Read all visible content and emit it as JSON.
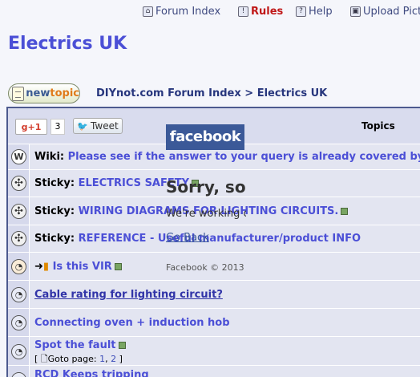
{
  "topnav": {
    "forum_index": "Forum Index",
    "rules": "Rules",
    "help": "Help",
    "upload": "Upload Pict"
  },
  "site_title": "Electrics UK",
  "newtopic": {
    "pre": "new",
    "post": "topic"
  },
  "breadcrumb": {
    "index": "DIYnot.com Forum Index",
    "sep": ">",
    "current": "Electrics UK"
  },
  "social": {
    "gplus_label": "g+1",
    "gplus_count": "3",
    "tweet_label": "Tweet"
  },
  "table": {
    "topics_header": "Topics"
  },
  "rows": [
    {
      "prefix": "Wiki:",
      "title": "Please see if the answer to your query is already covered by the Wi"
    },
    {
      "prefix": "Sticky:",
      "title": "ELECTRICS SAFETY"
    },
    {
      "prefix": "Sticky:",
      "title": "WIRING DIAGRAMS FOR LIGHTING CIRCUITS."
    },
    {
      "prefix": "Sticky:",
      "title": "REFERENCE - Useful manufacturer/product INFO"
    },
    {
      "prefix": "",
      "title": "Is this VIR"
    },
    {
      "prefix": "",
      "title": "Cable rating for lighting circuit?"
    },
    {
      "prefix": "",
      "title": "Connecting oven + induction hob"
    },
    {
      "prefix": "",
      "title": "Spot the fault",
      "goto_label": "Goto page:",
      "page1": "1",
      "page2": "2"
    },
    {
      "prefix": "",
      "title": "RCD Keeps tripping"
    }
  ],
  "facebook": {
    "logo": "facebook",
    "sorry": "Sorry, something went wrong.",
    "working": "We're working on getting this fixed as soon as we can.",
    "back": "Go Back",
    "copyright": "Facebook © 2013"
  },
  "colors": {
    "link": "#4b4fd6",
    "rules": "#c01818",
    "facebook": "#3b5998"
  }
}
